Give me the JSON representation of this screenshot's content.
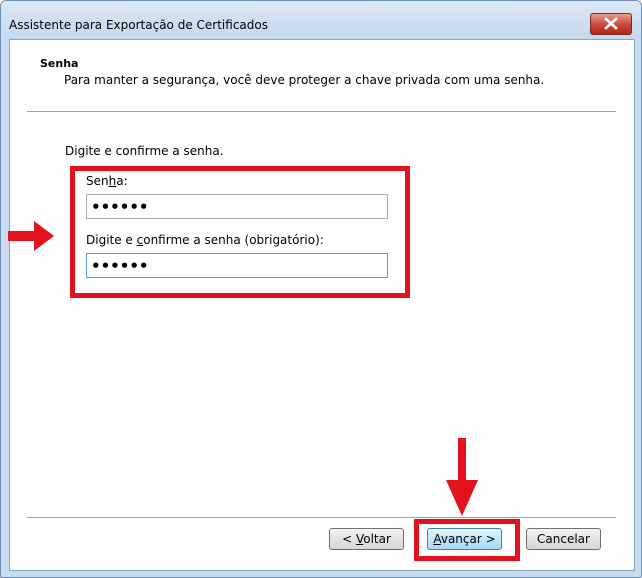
{
  "window": {
    "title": "Assistente para Exportação de Certificados"
  },
  "header": {
    "title": "Senha",
    "subtitle": "Para manter a segurança, você deve proteger a chave privada com uma senha."
  },
  "form": {
    "instruction": "Digite e confirme a senha.",
    "password_label_pre": "Sen",
    "password_label_key": "h",
    "password_label_post": "a:",
    "password_value": "••••••",
    "confirm_label_pre": "Digite e ",
    "confirm_label_key": "c",
    "confirm_label_post": "onfirme a senha (obrigatório):",
    "confirm_value": "••••••"
  },
  "buttons": {
    "back_pre": "< ",
    "back_key": "V",
    "back_post": "oltar",
    "next_key": "A",
    "next_post": "vançar >",
    "cancel": "Cancelar"
  },
  "annotations": {
    "highlight_color": "#e2121e"
  }
}
